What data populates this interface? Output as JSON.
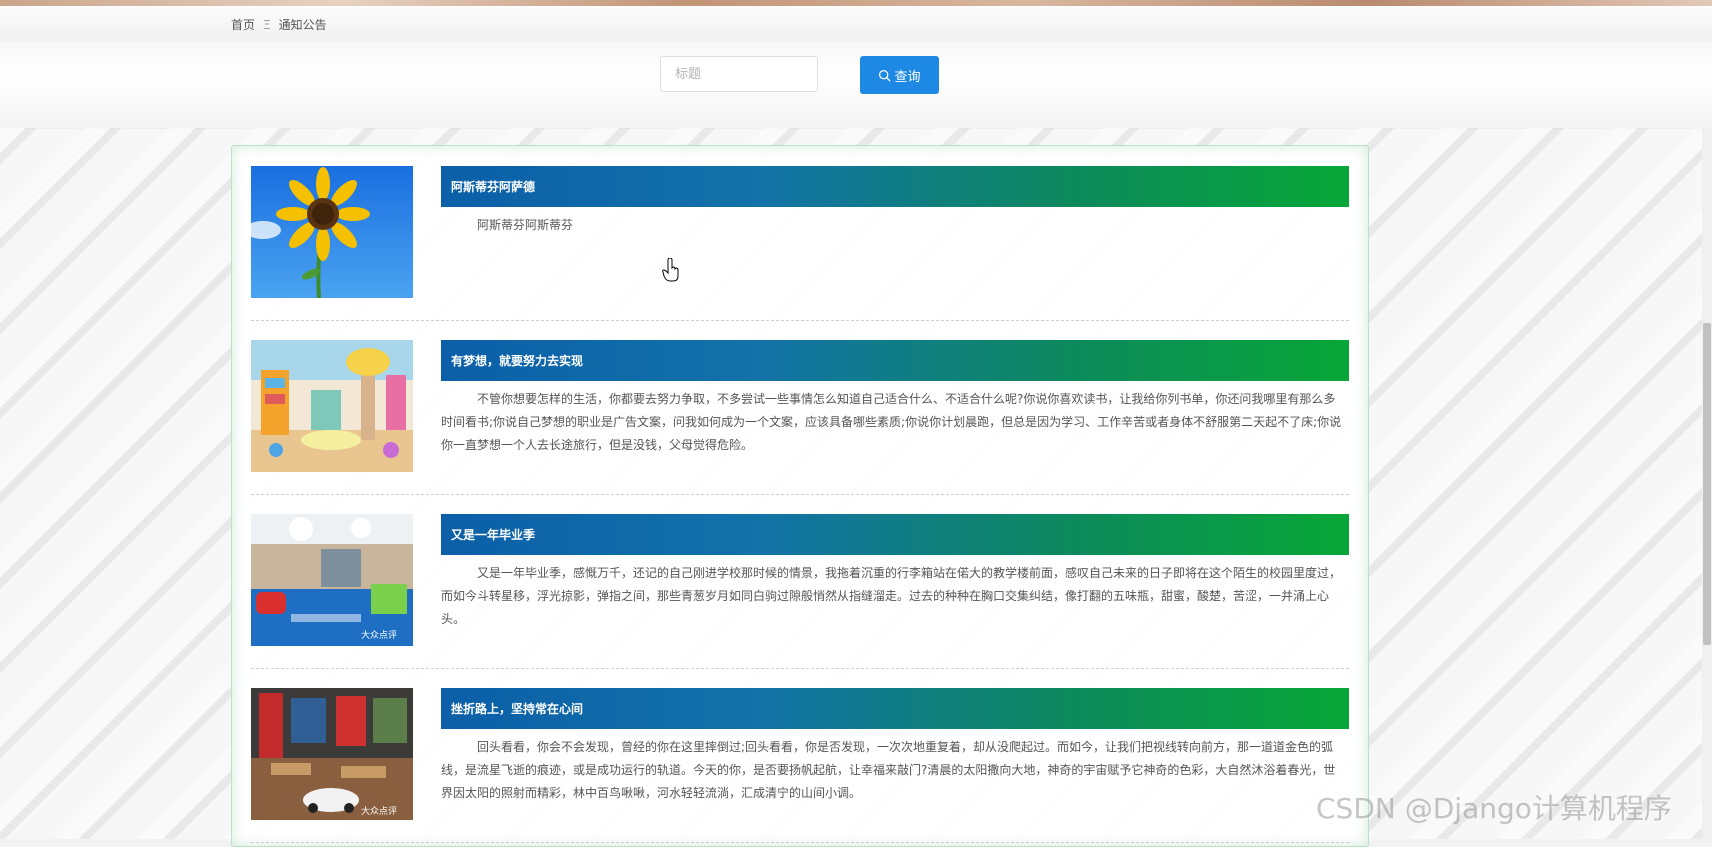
{
  "breadcrumb": {
    "home": "首页",
    "separator": "Ξ",
    "current": "通知公告"
  },
  "search": {
    "placeholder": "标题",
    "value": "",
    "button_label": "查询"
  },
  "notices": [
    {
      "title": "阿斯蒂芬阿萨德",
      "content": "阿斯蒂芬阿斯蒂芬",
      "image": "sunflower"
    },
    {
      "title": "有梦想，就要努力去实现",
      "content": "不管你想要怎样的生活，你都要去努力争取，不多尝试一些事情怎么知道自己适合什么、不适合什么呢?你说你喜欢读书，让我给你列书单，你还问我哪里有那么多时间看书;你说自己梦想的职业是广告文案，问我如何成为一个文案，应该具备哪些素质;你说你计划晨跑，但总是因为学习、工作辛苦或者身体不舒服第二天起不了床;你说你一直梦想一个人去长途旅行，但是没钱，父母觉得危险。",
      "image": "kids-playroom"
    },
    {
      "title": "又是一年毕业季",
      "content": "又是一年毕业季，感慨万千，还记的自己刚进学校那时候的情景，我拖着沉重的行李箱站在偌大的教学楼前面，感叹自己未来的日子即将在这个陌生的校园里度过，而如今斗转星移，浮光掠影，弹指之间，那些青葱岁月如同白驹过隙般悄然从指缝溜走。过去的种种在胸口交集纠结，像打翻的五味瓶，甜蜜，酸楚，苦涩，一并涌上心头。",
      "image": "play-area"
    },
    {
      "title": "挫折路上，坚持常在心间",
      "content": "回头看看，你会不会发现，曾经的你在这里摔倒过;回头看看，你是否发现，一次次地重复着，却从没爬起过。而如今，让我们把视线转向前方，那一道道金色的弧线，是流星飞逝的痕迹，或是成功运行的轨道。今天的你，是否要扬帆起航，让幸福来敲门?清晨的太阳撒向大地，神奇的宇宙赋予它神奇的色彩，大自然沐浴着春光，世界因太阳的照射而精彩，林中百鸟啾啾，河水轻轻流淌，汇成清宁的山间小调。",
      "image": "classroom"
    }
  ],
  "watermark": "CSDN @Django计算机程序"
}
